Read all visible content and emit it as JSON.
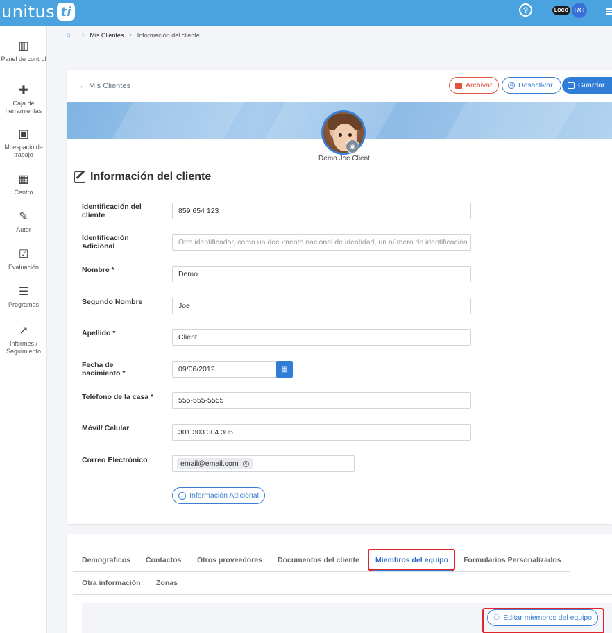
{
  "app": {
    "logo_text": "unitus",
    "logo_mark": "ti"
  },
  "topbar": {
    "help": "?",
    "loco": "LOCO",
    "avatar": "RG"
  },
  "sidebar": {
    "items": [
      {
        "icon": "bar-chart-icon",
        "glyph": "📊",
        "label": "Panel de control"
      },
      {
        "icon": "puzzle-icon",
        "glyph": "🧩",
        "label": "Caja de herramientas"
      },
      {
        "icon": "briefcase-icon",
        "glyph": "💼",
        "label": "Mi espacio de trabajo"
      },
      {
        "icon": "building-icon",
        "glyph": "🏢",
        "label": "Centro"
      },
      {
        "icon": "author-icon",
        "glyph": "✍",
        "label": "Autor"
      },
      {
        "icon": "checkbox-icon",
        "glyph": "☑",
        "label": "Evaluación"
      },
      {
        "icon": "document-icon",
        "glyph": "📄",
        "label": "Programas"
      },
      {
        "icon": "trend-icon",
        "glyph": "📈",
        "label": "Informes / Seguimiento"
      }
    ]
  },
  "breadcrumb": {
    "items": [
      "Mis Clientes",
      "Información del cliente"
    ]
  },
  "header": {
    "back": "← Mis Clientes",
    "archive": "Archivar",
    "deactivate": "Desactivar",
    "save": "Guardar"
  },
  "client": {
    "display_name": "Demo Joe Client"
  },
  "form": {
    "title": "Información del cliente",
    "fields": [
      {
        "label": "Identificación del cliente",
        "value": "859 654 123",
        "placeholder": ""
      },
      {
        "label": "Identificación Adicional",
        "value": "",
        "placeholder": "Otro identificador, como un documento nacional de identidad, un número de identificación"
      },
      {
        "label": "Nombre *",
        "value": "Demo",
        "placeholder": ""
      },
      {
        "label": "Segundo Nombre",
        "value": "Joe",
        "placeholder": ""
      },
      {
        "label": "Apellido *",
        "value": "Client",
        "placeholder": ""
      },
      {
        "label": "Fecha de nacimiento *",
        "value": "09/06/2012",
        "placeholder": ""
      },
      {
        "label": "Teléfono de la casa *",
        "value": "555-555-5555",
        "placeholder": ""
      },
      {
        "label": "Móvil/ Celular",
        "value": "301 303 304 305",
        "placeholder": ""
      },
      {
        "label": "Correo Electrónico",
        "value": "email@email.com",
        "placeholder": ""
      }
    ],
    "more_info": "Información Adicional"
  },
  "tabs": {
    "items": [
      "Demograficos",
      "Contactos",
      "Otros proveedores",
      "Documentos del cliente",
      "Miembros del equipo",
      "Formularios Personalizados",
      "Otra información",
      "Zonas"
    ],
    "active": "Miembros del equipo",
    "edit_team": "Editar miembros del equipo"
  },
  "colors": {
    "primary": "#2f7dd6",
    "topbar": "#4aa3df",
    "danger": "#e0533d",
    "highlight": "#e0242e"
  }
}
